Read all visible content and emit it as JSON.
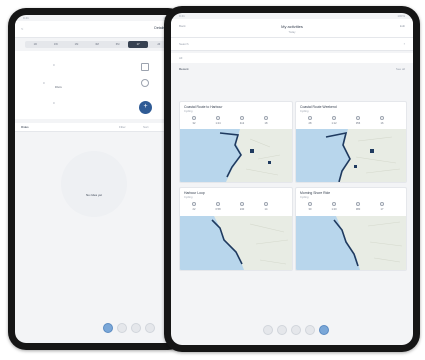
{
  "left_tablet": {
    "status_left": "9:41",
    "status_right": "100%",
    "header": {
      "back": "<",
      "title": "Details",
      "action": "Edit"
    },
    "segments": [
      "1D",
      "1W",
      "1M",
      "3M",
      "6M",
      "1Y",
      "All"
    ],
    "stats_left": [
      {
        "label": "0",
        "value": ""
      },
      {
        "label": "0",
        "value": "0 km"
      },
      {
        "label": "0",
        "value": ""
      }
    ],
    "section_label": "Rides",
    "section_links": [
      "Filter",
      "Sort"
    ],
    "empty_state_text": "No rides yet",
    "fab_icon": "plus-icon"
  },
  "right_tablet": {
    "status_left": "9:41",
    "status_right": "100%",
    "header": {
      "left": "Back",
      "title": "My activities",
      "right": "Edit"
    },
    "subheader": "Today",
    "search_placeholder": "Search",
    "filter_label": "All",
    "list_title": "Recent",
    "list_link": "See all",
    "cards": [
      {
        "title": "Coastal Route to Harbour",
        "subtitle": "Cycling",
        "stats": [
          "32",
          "1:24",
          "412",
          "18"
        ]
      },
      {
        "title": "Coastal Route Weekend",
        "subtitle": "Cycling",
        "stats": [
          "28",
          "1:12",
          "356",
          "16"
        ]
      },
      {
        "title": "Harbour Loop",
        "subtitle": "Cycling",
        "stats": [
          "22",
          "0:58",
          "240",
          "14"
        ]
      },
      {
        "title": "Morning Shore Ride",
        "subtitle": "Cycling",
        "stats": [
          "30",
          "1:20",
          "380",
          "17"
        ]
      }
    ],
    "tabbar": [
      "home-icon",
      "map-icon",
      "stats-icon",
      "settings-icon",
      "profile-icon"
    ]
  },
  "colors": {
    "sea": "#b8d6ec",
    "land": "#e8ece4",
    "route": "#1f3a5f",
    "accent": "#2f5b95",
    "tab_active": "#7aa7d8"
  }
}
